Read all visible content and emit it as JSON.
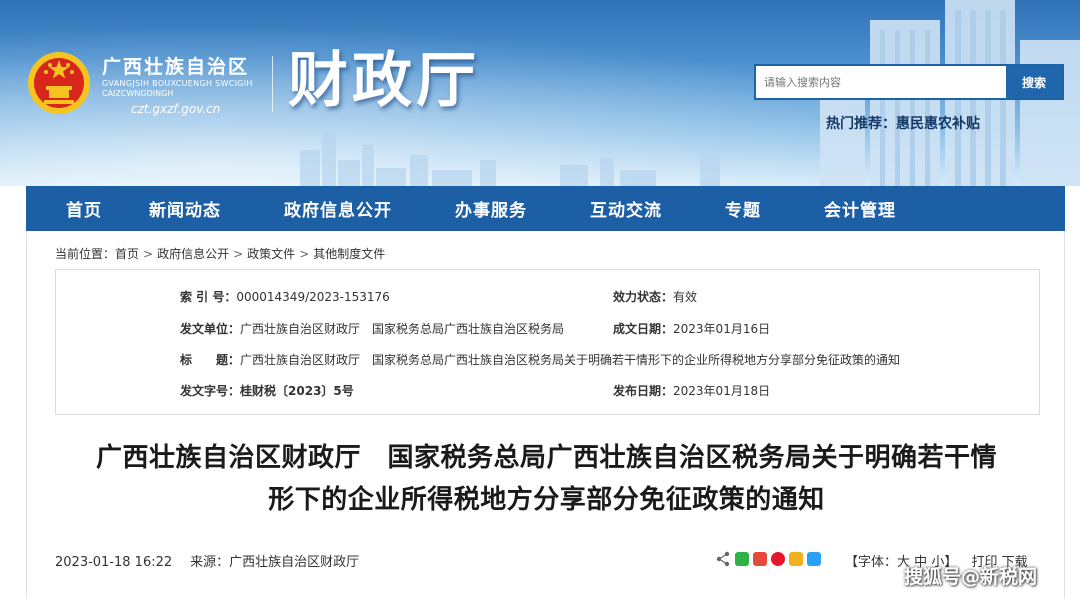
{
  "header": {
    "region_cn": "广西壮族自治区",
    "region_za_1": "GVANGJSIH BOUXCUENGH SWCIGIH",
    "region_za_2": "CAIZCWNGDINGH",
    "site_url": "czt.gxzf.gov.cn",
    "dept_name": "财政厅",
    "search": {
      "placeholder": "请输入搜索内容",
      "button": "搜索"
    },
    "hot": {
      "label": "热门推荐：",
      "link": "惠民惠农补贴"
    }
  },
  "nav": {
    "items": [
      "首页",
      "新闻动态",
      "政府信息公开",
      "办事服务",
      "互动交流",
      "专题",
      "会计管理"
    ]
  },
  "breadcrumb": {
    "prefix": "当前位置：",
    "items": [
      "首页",
      "政府信息公开",
      "政策文件",
      "其他制度文件"
    ]
  },
  "meta": {
    "index_label": "索 引 号：",
    "index_value": "000014349/2023-153176",
    "status_label": "效力状态：",
    "status_value": "有效",
    "issuer_label": "发文单位：",
    "issuer_value": "广西壮族自治区财政厅　国家税务总局广西壮族自治区税务局",
    "date_made_label": "成文日期：",
    "date_made_value": "2023年01月16日",
    "title_label": "标　　题：",
    "title_value": "广西壮族自治区财政厅　国家税务总局广西壮族自治区税务局关于明确若干情形下的企业所得税地方分享部分免征政策的通知",
    "doc_no_label": "发文字号：",
    "doc_no_value": "桂财税〔2023〕5号",
    "publish_label": "发布日期：",
    "publish_value": "2023年01月18日"
  },
  "article": {
    "title_line1": "广西壮族自治区财政厅　国家税务总局广西壮族自治区税务局关于明确若干情",
    "title_line2": "形下的企业所得税地方分享部分免征政策的通知",
    "datetime": "2023-01-18 16:22",
    "source_label": "来源：",
    "source_value": "广西壮族自治区财政厅",
    "font_label_open": "【字体：",
    "font_large": "大",
    "font_medium": "中",
    "font_small": "小",
    "font_label_close": "】",
    "print": "打印",
    "download": "下载"
  },
  "watermark": "搜狐号@新税网",
  "colors": {
    "nav_bg": "#1d5fa5",
    "search_btn": "#1f66ad",
    "header_sky_top": "#2f72b6"
  },
  "icons": [
    "national-emblem-icon",
    "share-icon",
    "wechat-icon",
    "weibo-icon",
    "qzone-icon",
    "qq-icon"
  ]
}
